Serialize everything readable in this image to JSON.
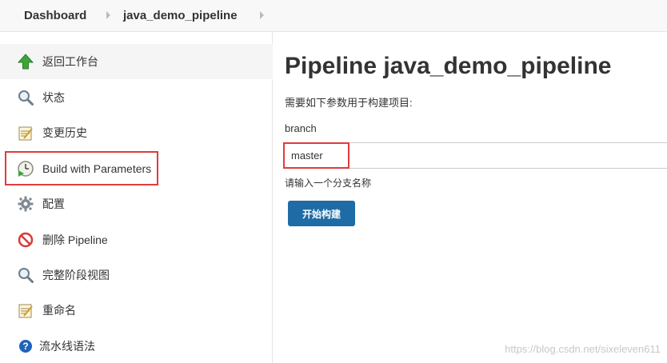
{
  "breadcrumb": {
    "items": [
      "Dashboard",
      "java_demo_pipeline"
    ]
  },
  "sidebar": {
    "items": [
      {
        "label": "返回工作台",
        "icon": "up-arrow-icon"
      },
      {
        "label": "状态",
        "icon": "magnifier-icon"
      },
      {
        "label": "变更历史",
        "icon": "notepad-icon"
      },
      {
        "label": "Build with Parameters",
        "icon": "clock-play-icon"
      },
      {
        "label": "配置",
        "icon": "gear-icon"
      },
      {
        "label": "删除 Pipeline",
        "icon": "no-entry-icon"
      },
      {
        "label": "完整阶段视图",
        "icon": "magnifier-icon"
      },
      {
        "label": "重命名",
        "icon": "notepad-icon"
      },
      {
        "label": "流水线语法",
        "icon": "help-icon"
      }
    ]
  },
  "main": {
    "title": "Pipeline java_demo_pipeline",
    "description": "需要如下参数用于构建项目:",
    "param_name": "branch",
    "param_value": "master",
    "param_hint": "请输入一个分支名称",
    "build_button": "开始构建"
  },
  "watermark": "https://blog.csdn.net/sixeleven611",
  "colors": {
    "highlight": "#e03c3c",
    "button": "#1f6ba5"
  }
}
